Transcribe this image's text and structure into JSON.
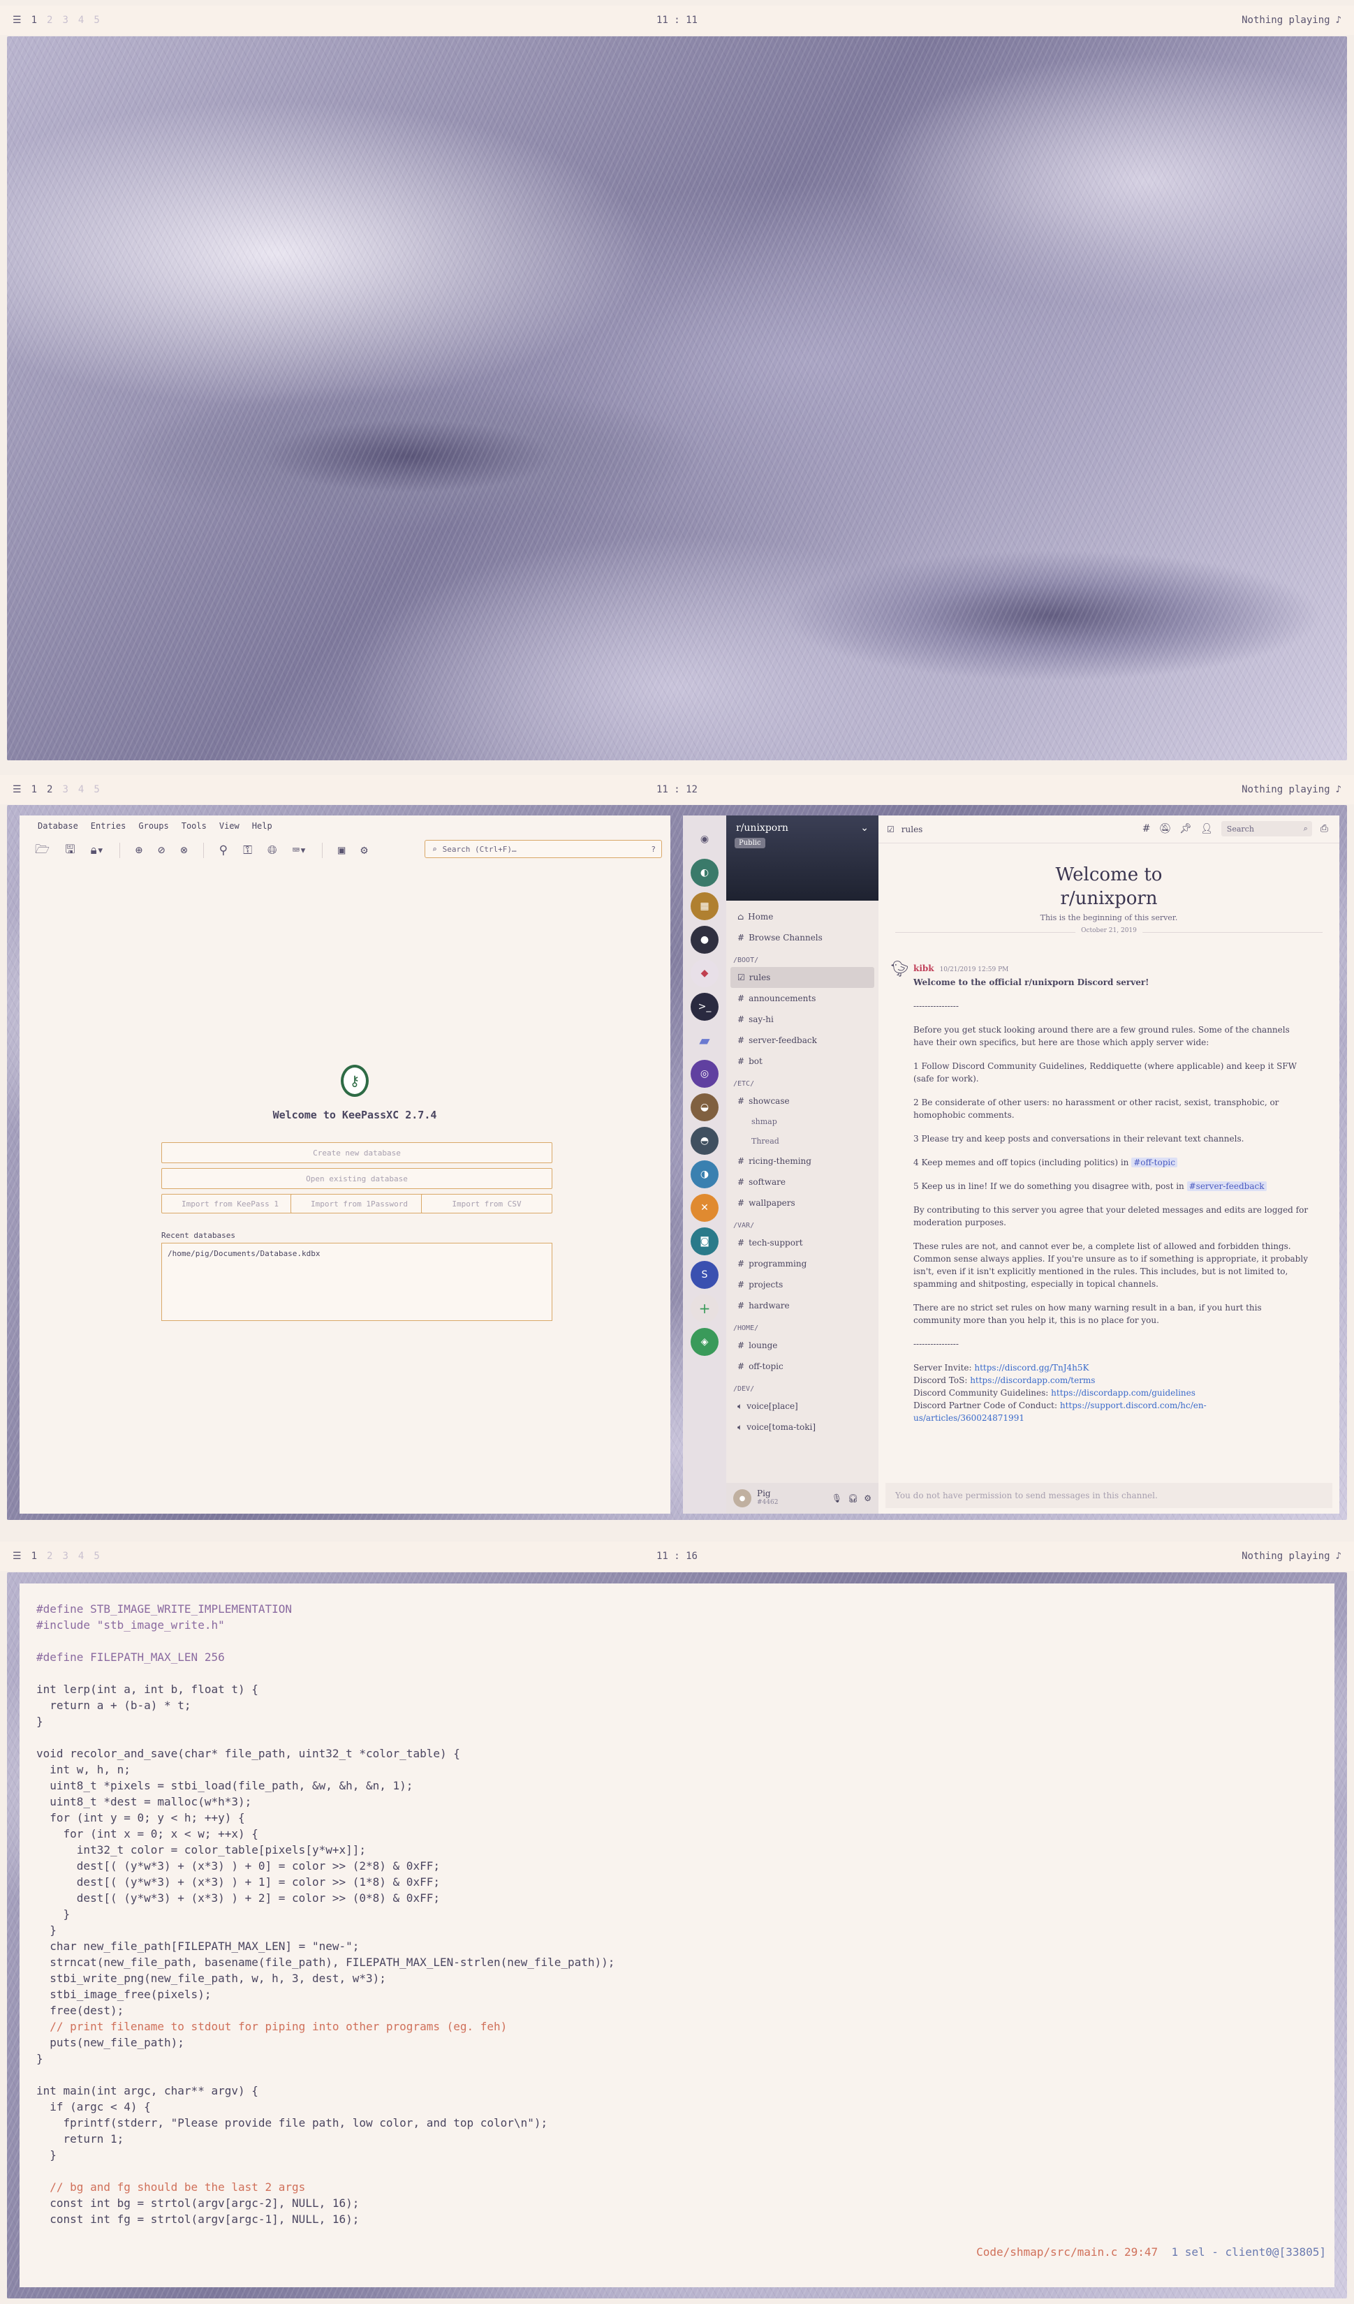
{
  "bars": [
    {
      "workspaces": [
        "1",
        "2",
        "3",
        "4",
        "5"
      ],
      "clock": "11 : 11",
      "now_playing": "Nothing playing"
    },
    {
      "workspaces": [
        "1",
        "2",
        "3",
        "4",
        "5"
      ],
      "clock": "11 : 12",
      "now_playing": "Nothing playing"
    },
    {
      "workspaces": [
        "1",
        "2",
        "3",
        "4",
        "5"
      ],
      "clock": "11 : 16",
      "now_playing": "Nothing playing"
    }
  ],
  "keepass": {
    "menu": [
      "Database",
      "Entries",
      "Groups",
      "Tools",
      "View",
      "Help"
    ],
    "search_placeholder": "Search (Ctrl+F)…",
    "welcome": "Welcome to KeePassXC 2.7.4",
    "create": "Create new database",
    "open": "Open existing database",
    "import_kp1": "Import from KeePass 1",
    "import_1p": "Import from 1Password",
    "import_csv": "Import from CSV",
    "recent_label": "Recent databases",
    "recent_item": "/home/pig/Documents/Database.kdbx"
  },
  "discord": {
    "server_name": "r/unixporn",
    "public": "Public",
    "home": "Home",
    "browse": "Browse Channels",
    "categories": [
      {
        "name": "/BOOT/",
        "channels": [
          "rules",
          "announcements",
          "say-hi",
          "server-feedback",
          "bot"
        ]
      },
      {
        "name": "/ETC/",
        "channels": [
          "showcase",
          "ricing-theming",
          "software",
          "wallpapers"
        ]
      },
      {
        "name": "/VAR/",
        "channels": [
          "tech-support",
          "programming",
          "projects",
          "hardware"
        ]
      },
      {
        "name": "/HOME/",
        "channels": [
          "lounge",
          "off-topic"
        ]
      },
      {
        "name": "/DEV/",
        "channels": [
          "voice[place]",
          "voice[toma-toki]"
        ]
      }
    ],
    "threads": [
      "shmap",
      "Thread"
    ],
    "user": "Pig",
    "user_tag": "#4462",
    "channel": "rules",
    "search": "Search",
    "welcome_l1": "Welcome to",
    "welcome_l2": "r/unixporn",
    "beginning": "This is the beginning of this server.",
    "date": "October 21, 2019",
    "author": "kibk",
    "timestamp": "10/21/2019 12:59 PM",
    "m_title": "Welcome to the official r/unixporn Discord server!",
    "m_sep": "----------------",
    "m_intro": "Before you get stuck looking around there are a few ground rules. Some of the channels have their own specifics, but here are those which apply server wide:",
    "m_r1": "1 Follow Discord Community Guidelines, Reddiquette (where applicable) and keep it SFW (safe for work).",
    "m_r2": "2 Be considerate of other users: no harassment or other racist, sexist, transphobic, or homophobic comments.",
    "m_r3": "3 Please try and keep posts and conversations in their relevant text channels.",
    "m_r4": "4 Keep memes and off topics (including politics) in",
    "m_r4_ch": "#off-topic",
    "m_r5": "5 Keep us in line! If we do something you disagree with, post in",
    "m_r5_ch": "#server-feedback",
    "m_p1": "By contributing to this server you agree that your deleted messages and edits are logged for moderation purposes.",
    "m_p2": "These rules are not, and cannot ever be, a complete list of allowed and forbidden things. Common sense always applies. If you're unsure as to if something is appropriate, it probably isn't, even if it isn't explicitly mentioned in the rules. This includes, but is not limited to, spamming and shitposting, especially in topical channels.",
    "m_p3": "There are no strict set rules on how many warning result in a ban, if you hurt this community more than you help it, this is no place for you.",
    "m_sep2": "----------------",
    "l_invite": "Server Invite:",
    "u_invite": "https://discord.gg/TnJ4h5K",
    "l_tos": "Discord ToS:",
    "u_tos": "https://discordapp.com/terms",
    "l_cg": "Discord Community Guidelines:",
    "u_cg": "https://discordapp.com/guidelines",
    "l_pc": "Discord Partner Code of Conduct:",
    "u_pc": "https://support.discord.com/hc/en-us/articles/360024871991",
    "input_placeholder": "You do not have permission to send messages in this channel."
  },
  "editor": {
    "lines": [
      "#define STB_IMAGE_WRITE_IMPLEMENTATION",
      "#include \"stb_image_write.h\"",
      "",
      "#define FILEPATH_MAX_LEN 256",
      "",
      "int lerp(int a, int b, float t) {",
      "  return a + (b-a) * t;",
      "}",
      "",
      "void recolor_and_save(char* file_path, uint32_t *color_table) {",
      "  int w, h, n;",
      "  uint8_t *pixels = stbi_load(file_path, &w, &h, &n, 1);",
      "  uint8_t *dest = malloc(w*h*3);",
      "  for (int y = 0; y < h; ++y) {",
      "    for (int x = 0; x < w; ++x) {",
      "      int32_t color = color_table[pixels[y*w+x]];",
      "      dest[( (y*w*3) + (x*3) ) + 0] = color >> (2*8) & 0xFF;",
      "      dest[( (y*w*3) + (x*3) ) + 1] = color >> (1*8) & 0xFF;",
      "      dest[( (y*w*3) + (x*3) ) + 2] = color >> (0*8) & 0xFF;",
      "    }",
      "  }",
      "  char new_file_path[FILEPATH_MAX_LEN] = \"new-\";",
      "  strncat(new_file_path, basename(file_path), FILEPATH_MAX_LEN-strlen(new_file_path));",
      "  stbi_write_png(new_file_path, w, h, 3, dest, w*3);",
      "  stbi_image_free(pixels);",
      "  free(dest);",
      "  // print filename to stdout for piping into other programs (eg. feh)",
      "  puts(new_file_path);",
      "}",
      "",
      "int main(int argc, char** argv) {",
      "  if (argc < 4) {",
      "    fprintf(stderr, \"Please provide file path, low color, and top color\\n\");",
      "    return 1;",
      "  }",
      "",
      "  // bg and fg should be the last 2 args",
      "  const int bg = strtol(argv[argc-2], NULL, 16);",
      "  const int fg = strtol(argv[argc-1], NULL, 16);"
    ],
    "status_path": "Code/shmap/src/main.c 29:47",
    "status_sel": "1 sel - client0@[33805]"
  }
}
